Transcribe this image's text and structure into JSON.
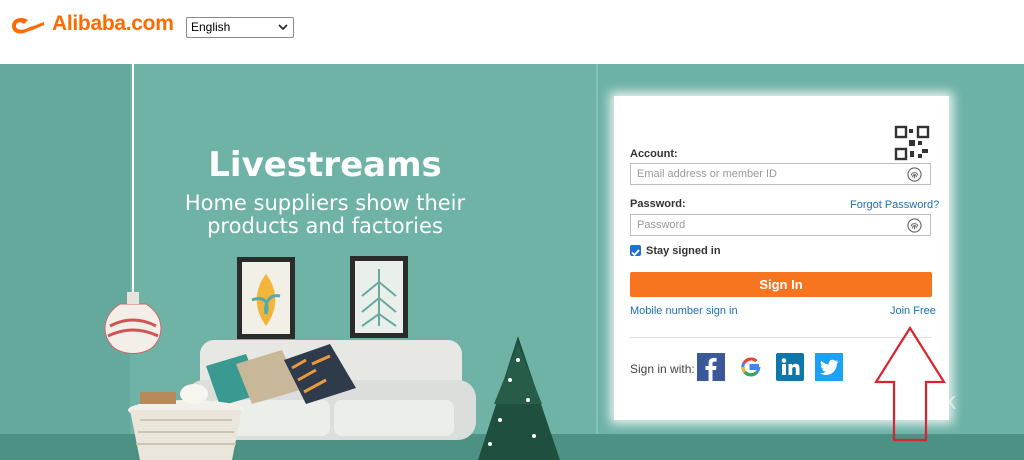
{
  "header": {
    "brand": "Alibaba.com",
    "language": {
      "selected": "English"
    }
  },
  "hero": {
    "title": "Livestreams",
    "subtitle_line1": "Home suppliers show their",
    "subtitle_line2": "products and factories"
  },
  "login": {
    "account_label": "Account:",
    "account_placeholder": "Email address or member ID",
    "password_label": "Password:",
    "forgot_password": "Forgot Password?",
    "password_placeholder": "Password",
    "stay_signed_in": "Stay signed in",
    "stay_signed_in_checked": true,
    "sign_in_button": "Sign In",
    "mobile_sign_in": "Mobile number sign in",
    "join_free": "Join Free",
    "sign_in_with": "Sign in with:",
    "social": [
      "facebook-icon",
      "google-icon",
      "linkedin-icon",
      "twitter-icon"
    ]
  },
  "watermark": "ck",
  "colors": {
    "brand_orange": "#ff6a00",
    "button_orange": "#f7751e",
    "hero_teal": "#6fb3a7",
    "link_blue": "#1c6fb5",
    "arrow_red": "#d9232e"
  }
}
